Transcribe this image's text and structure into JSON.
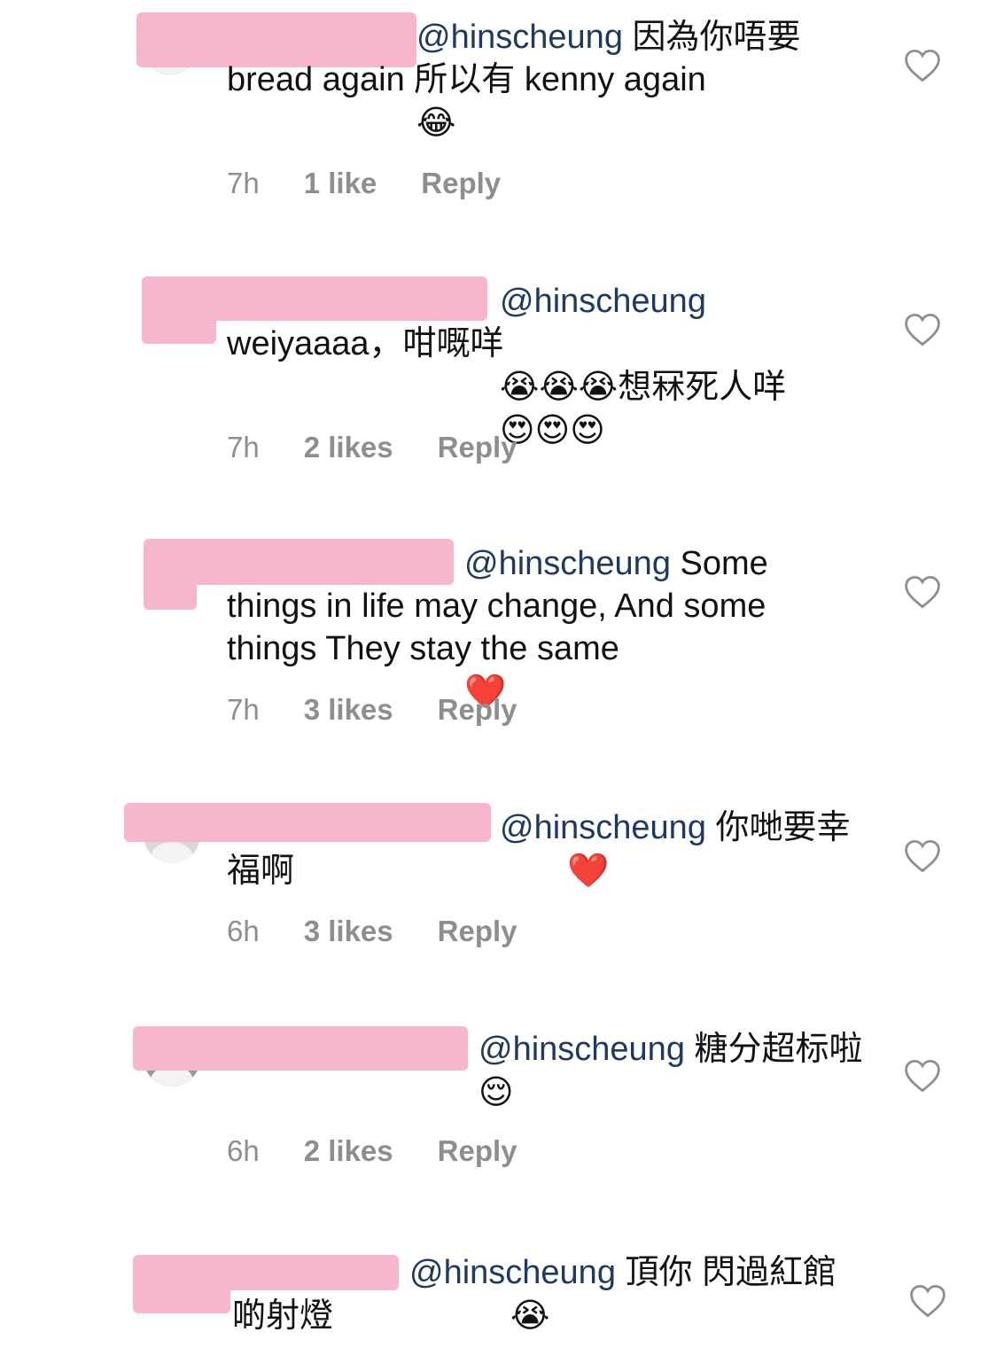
{
  "heart_icon": "heart-outline-icon",
  "colors": {
    "mention": "#1f3a60",
    "meta": "#8e8e8e",
    "redaction": "#f7b6cc"
  },
  "comments": [
    {
      "mention": "@hinscheung",
      "text": " 因為你唔要bread again 所以有 kenny again ",
      "emojis": "😂",
      "time": "7h",
      "likes": "1 like",
      "reply": "Reply"
    },
    {
      "mention": "@hinscheung",
      "text": " weiyaaaa，咁嘅咩",
      "emojis_mid": "😭😭😭",
      "text_after": "想冧死人咩",
      "emojis": "😍😍😍",
      "time": "7h",
      "likes": "2 likes",
      "reply": "Reply"
    },
    {
      "mention": "@hinscheung",
      "text": " Some things in life may change, And some things They stay the same ",
      "emojis": "❤️",
      "time": "7h",
      "likes": "3 likes",
      "reply": "Reply"
    },
    {
      "mention": "@hinscheung",
      "text": " 你哋要幸福啊",
      "emojis": "❤️",
      "time": "6h",
      "likes": "3 likes",
      "reply": "Reply"
    },
    {
      "mention": "@hinscheung",
      "text": " 糖分超标啦",
      "emojis": "😌",
      "time": "6h",
      "likes": "2 likes",
      "reply": "Reply"
    },
    {
      "mention": "@hinscheung",
      "text": " 頂你 閃過紅館啲射燈",
      "emojis": "😭",
      "time": "",
      "likes": "",
      "reply": ""
    }
  ]
}
